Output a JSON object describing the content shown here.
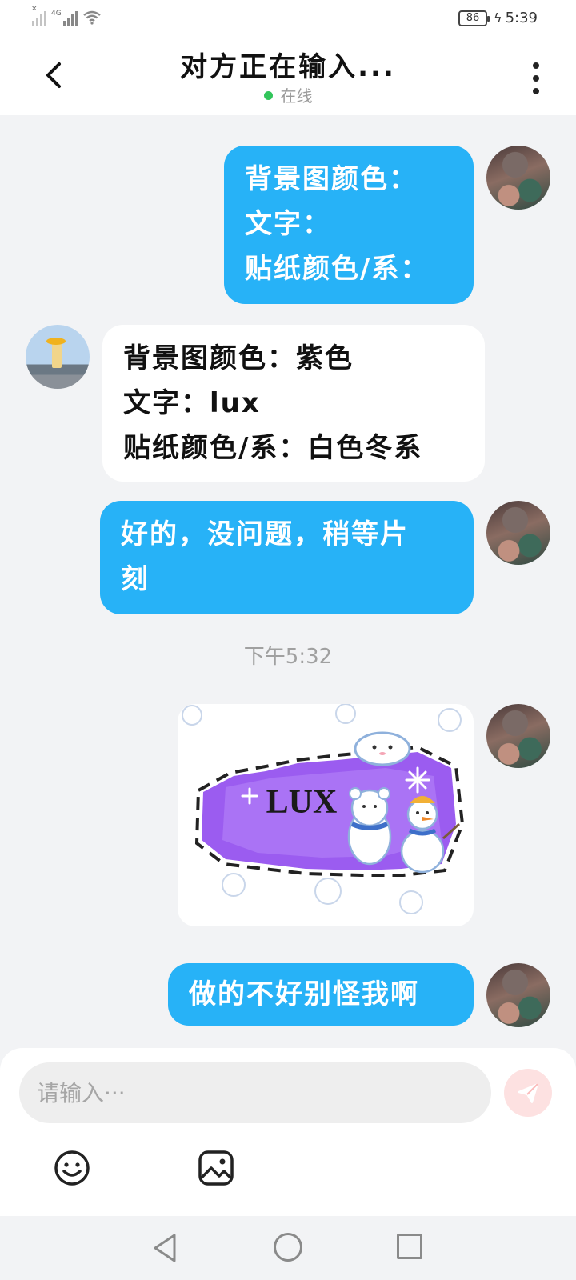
{
  "status_bar": {
    "network": "4G",
    "battery": "86",
    "time": "5:39"
  },
  "header": {
    "title": "对方正在输入...",
    "status": "在线"
  },
  "messages": [
    {
      "side": "right",
      "type": "text",
      "lines": [
        "背景图颜色：",
        "文字：",
        "贴纸颜色/系："
      ]
    },
    {
      "side": "left",
      "type": "text",
      "lines": [
        "背景图颜色：紫色",
        "文字：lux",
        "贴纸颜色/系：白色冬系"
      ]
    },
    {
      "side": "right",
      "type": "text",
      "lines": [
        "好的，没问题，稍等片",
        "刻"
      ]
    },
    {
      "side": "right",
      "type": "image",
      "image_text": "LUX"
    },
    {
      "side": "right",
      "type": "text",
      "lines": [
        "做的不好别怪我啊"
      ]
    }
  ],
  "timestamp": "下午5:32",
  "input": {
    "placeholder": "请输入···"
  },
  "icons": {
    "back": "back-arrow-icon",
    "more": "more-vertical-icon",
    "send": "send-icon",
    "emoji": "emoji-icon",
    "image": "image-icon"
  },
  "colors": {
    "bubble_blue": "#27b2f7",
    "online_dot": "#32c55b",
    "send_bg": "#fde1e1",
    "image_purple": "#9b5cf0"
  }
}
